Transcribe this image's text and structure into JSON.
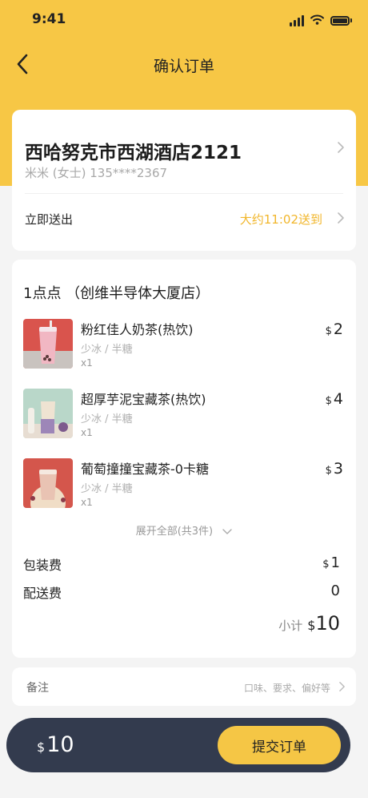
{
  "status_bar": {
    "time": "9:41"
  },
  "nav": {
    "title": "确认订单"
  },
  "address": {
    "title": "西哈努克市西湖酒店2121",
    "contact": "米米 (女士) 135****2367",
    "deliver_label": "立即送出",
    "deliver_time": "大约11:02送到"
  },
  "order": {
    "shop_name": "1点点 （创维半导体大厦店）",
    "currency": "$",
    "items": [
      {
        "name": "粉红佳人奶茶(热饮)",
        "options": "少冰 / 半糖",
        "qty": "x1",
        "price": "2"
      },
      {
        "name": "超厚芋泥宝藏茶(热饮)",
        "options": "少冰 / 半糖",
        "qty": "x1",
        "price": "4"
      },
      {
        "name": "葡萄撞撞宝藏茶-0卡糖",
        "options": "少冰 / 半糖",
        "qty": "x1",
        "price": "3"
      }
    ],
    "expand_label": "展开全部(共3件)",
    "packaging_label": "包装费",
    "packaging_fee": "1",
    "delivery_label": "配送费",
    "delivery_fee": "0",
    "subtotal_label": "小计",
    "subtotal": "10"
  },
  "note": {
    "label": "备注",
    "hint": "口味、要求、偏好等"
  },
  "footer": {
    "currency": "$",
    "total": "10",
    "submit_label": "提交订单"
  },
  "colors": {
    "brand_yellow": "#f7c745",
    "accent_text": "#f1b62b",
    "footer_bg": "#333b4e"
  },
  "icons": [
    "back-arrow-icon",
    "chevron-right-icon",
    "chevron-down-icon",
    "signal-icon",
    "wifi-icon",
    "battery-icon"
  ]
}
